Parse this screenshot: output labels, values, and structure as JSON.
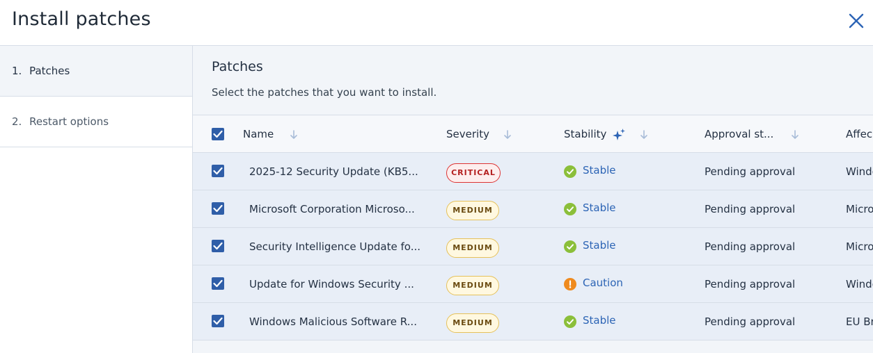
{
  "dialog": {
    "title": "Install patches",
    "close_icon": "close-icon"
  },
  "steps": [
    {
      "number": "1.",
      "label": "Patches",
      "active": true
    },
    {
      "number": "2.",
      "label": "Restart options",
      "active": false
    }
  ],
  "main": {
    "title": "Patches",
    "subtitle": "Select the patches that you want to install."
  },
  "table": {
    "columns": {
      "name": "Name",
      "severity": "Severity",
      "stability": "Stability",
      "approval": "Approval st...",
      "affected": "Affec"
    },
    "rows": [
      {
        "name": "2025-12 Security Update (KB5...",
        "severity": "CRITICAL",
        "severity_level": "critical",
        "stability": "Stable",
        "stability_icon": "check-circle-icon",
        "approval": "Pending approval",
        "affected": "Windo"
      },
      {
        "name": "Microsoft Corporation Microso...",
        "severity": "MEDIUM",
        "severity_level": "medium",
        "stability": "Stable",
        "stability_icon": "check-circle-icon",
        "approval": "Pending approval",
        "affected": "Micro"
      },
      {
        "name": "Security Intelligence Update fo...",
        "severity": "MEDIUM",
        "severity_level": "medium",
        "stability": "Stable",
        "stability_icon": "check-circle-icon",
        "approval": "Pending approval",
        "affected": "Micro"
      },
      {
        "name": "Update for Windows Security ...",
        "severity": "MEDIUM",
        "severity_level": "medium",
        "stability": "Caution",
        "stability_icon": "warning-circle-icon",
        "approval": "Pending approval",
        "affected": "Windo"
      },
      {
        "name": "Windows Malicious Software R...",
        "severity": "MEDIUM",
        "severity_level": "medium",
        "stability": "Stable",
        "stability_icon": "check-circle-icon",
        "approval": "Pending approval",
        "affected": "EU Br"
      }
    ]
  },
  "colors": {
    "accent": "#2f5ea8",
    "stable": "#8bbf3a",
    "caution": "#ef8a1e",
    "critical": "#d33333",
    "medium": "#e5c15a"
  }
}
